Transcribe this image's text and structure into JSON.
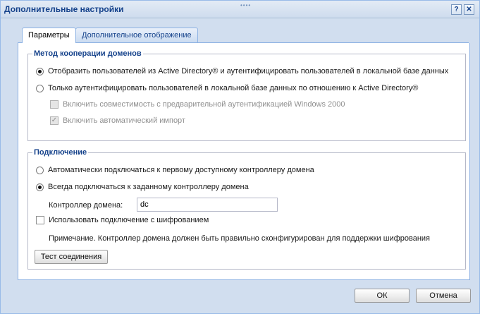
{
  "window": {
    "title": "Дополнительные настройки",
    "help_glyph": "?",
    "close_glyph": "✕"
  },
  "tabs": [
    {
      "label": "Параметры",
      "active": true
    },
    {
      "label": "Дополнительное отображение",
      "active": false
    }
  ],
  "domain_cooperation": {
    "legend": "Метод кооперации доменов",
    "options": [
      {
        "label": "Отобразить пользователей из Active Directory® и аутентифицировать пользователей в локальной базе данных",
        "selected": true
      },
      {
        "label": "Только аутентифицировать пользователей в локальной базе данных по отношению к Active Directory®",
        "selected": false
      }
    ],
    "checkboxes": [
      {
        "label": "Включить совместимость с предварительной аутентификацией Windows 2000",
        "checked": false,
        "disabled": true
      },
      {
        "label": "Включить автоматический импорт",
        "checked": true,
        "disabled": true
      }
    ]
  },
  "connection": {
    "legend": "Подключение",
    "options": [
      {
        "label": "Автоматически подключаться к первому доступному контроллеру домена",
        "selected": false
      },
      {
        "label": "Всегда подключаться к заданному контроллеру домена",
        "selected": true
      }
    ],
    "dc_label": "Контроллер домена:",
    "dc_value": "dc",
    "encryption_label": "Использовать подключение с шифрованием",
    "encryption_checked": false,
    "note": "Примечание. Контроллер домена должен быть правильно сконфигурирован для поддержки шифрования",
    "test_button": "Тест соединения"
  },
  "footer": {
    "ok": "ОК",
    "cancel": "Отмена"
  }
}
